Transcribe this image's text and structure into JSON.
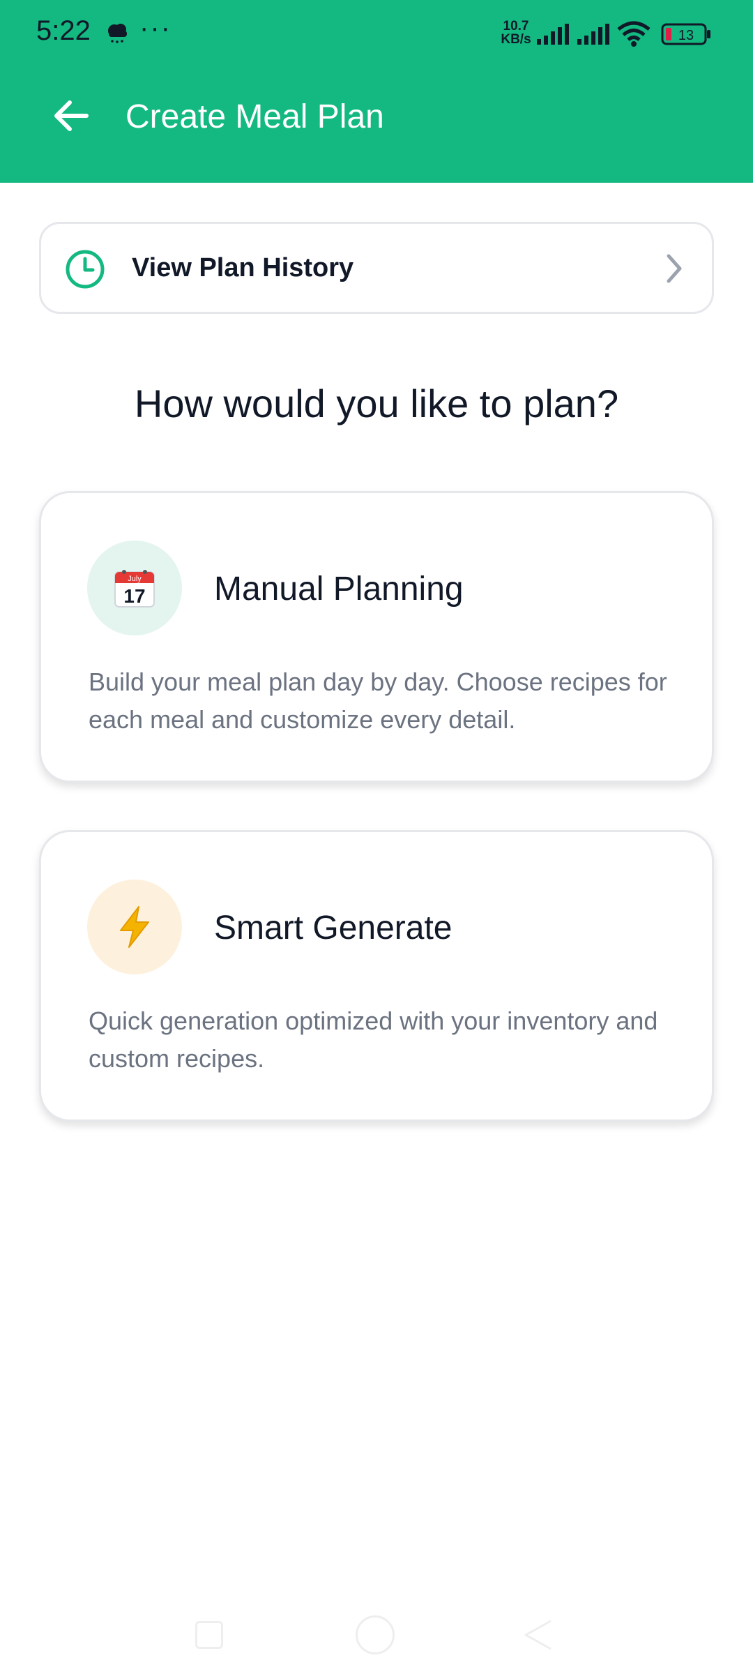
{
  "status_bar": {
    "time": "5:22",
    "dots": "···",
    "speed_value": "10.7",
    "speed_unit": "KB/s",
    "battery": "13",
    "icons": [
      "weather-cloud-icon",
      "signal-icon",
      "signal-icon",
      "wifi-icon",
      "battery-icon"
    ]
  },
  "app_bar": {
    "title": "Create Meal Plan",
    "back_icon": "arrow-left-icon"
  },
  "history": {
    "label": "View Plan History",
    "icon": "clock-icon",
    "chevron": "chevron-right-icon"
  },
  "question": "How would you like to plan?",
  "options": [
    {
      "title": "Manual Planning",
      "description": "Build your meal plan day by day. Choose recipes for each meal and customize every detail.",
      "icon": "calendar-icon",
      "calendar_month": "July",
      "calendar_day": "17",
      "icon_bg": "#e3f5ee"
    },
    {
      "title": "Smart Generate",
      "description": "Quick generation optimized with your inventory and custom recipes.",
      "icon": "lightning-icon",
      "icon_bg": "#fdf1dd"
    }
  ],
  "colors": {
    "brand": "#13b981",
    "text_primary": "#111827",
    "text_secondary": "#6b7280",
    "border": "#e5e7eb"
  }
}
